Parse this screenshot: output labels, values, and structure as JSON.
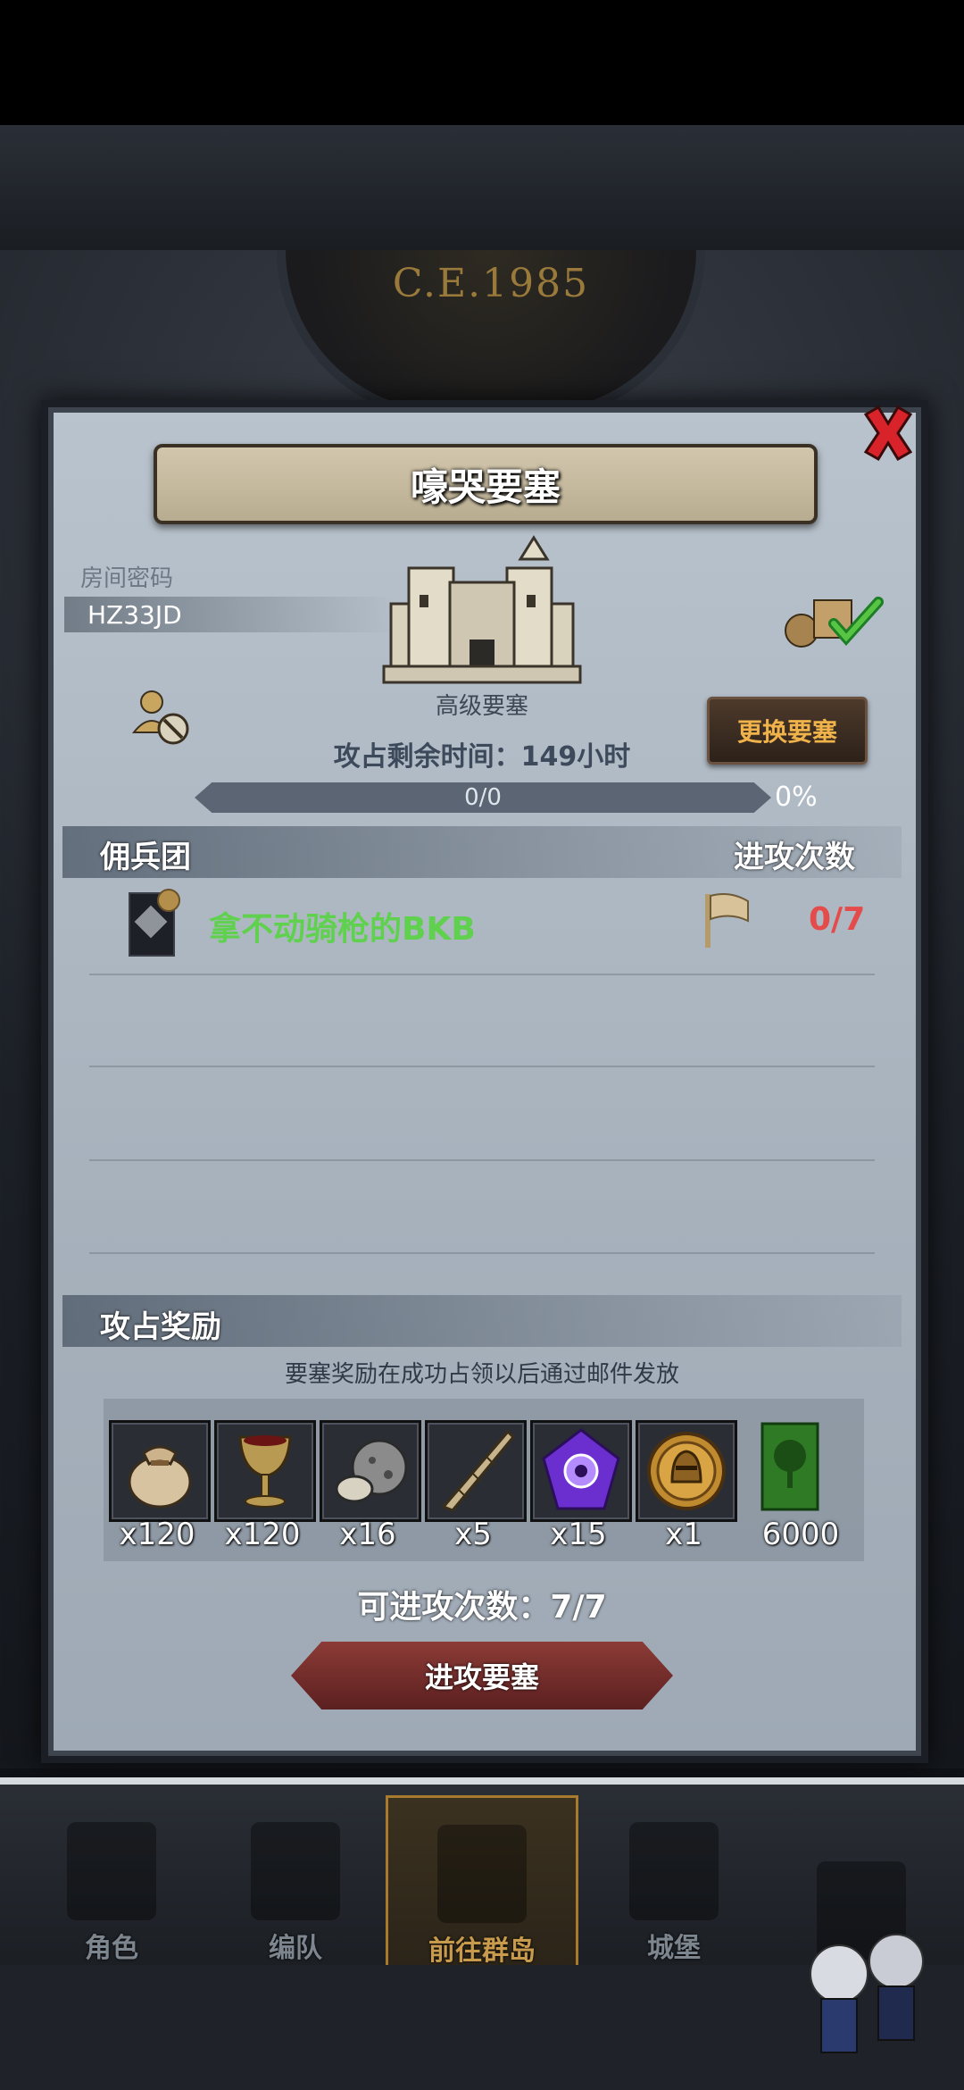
{
  "background": {
    "era": "C.E.1985"
  },
  "modal": {
    "title": "嚎哭要塞",
    "room_label": "房间密码",
    "room_code": "HZ33JD",
    "fortress_name": "高级要塞",
    "change_button": "更换要塞",
    "remaining_time": "攻占剩余时间：149小时",
    "progress": {
      "text": "0/0",
      "percent": "0%",
      "fraction": 0
    },
    "mercenary_header": "佣兵团",
    "attack_count_header": "进攻次数",
    "mercenaries": [
      {
        "name": "拿不动骑枪的BKB",
        "attacks": "0/7"
      }
    ],
    "reward_header": "攻占奖励",
    "reward_note": "要塞奖励在成功占领以后通过邮件发放",
    "rewards": [
      {
        "icon": "sack-icon",
        "qty": "x120"
      },
      {
        "icon": "goblet-icon",
        "qty": "x120"
      },
      {
        "icon": "ore-icon",
        "qty": "x16"
      },
      {
        "icon": "horn-icon",
        "qty": "x5"
      },
      {
        "icon": "purple-gem-icon",
        "qty": "x15"
      },
      {
        "icon": "helmet-coin-icon",
        "qty": "x1"
      },
      {
        "icon": "tree-banner-icon",
        "qty": "6000"
      }
    ],
    "attempts": "可进攻次数：7/7",
    "attack_button": "进攻要塞"
  },
  "nav": [
    {
      "label": "角色"
    },
    {
      "label": "编队"
    },
    {
      "label": "前往群岛",
      "active": true
    },
    {
      "label": "城堡"
    },
    {
      "label": ""
    }
  ],
  "colors": {
    "merc_name": "#5fd14e",
    "attack_count": "#e44b4b",
    "change_button_text": "#f0b24a"
  }
}
